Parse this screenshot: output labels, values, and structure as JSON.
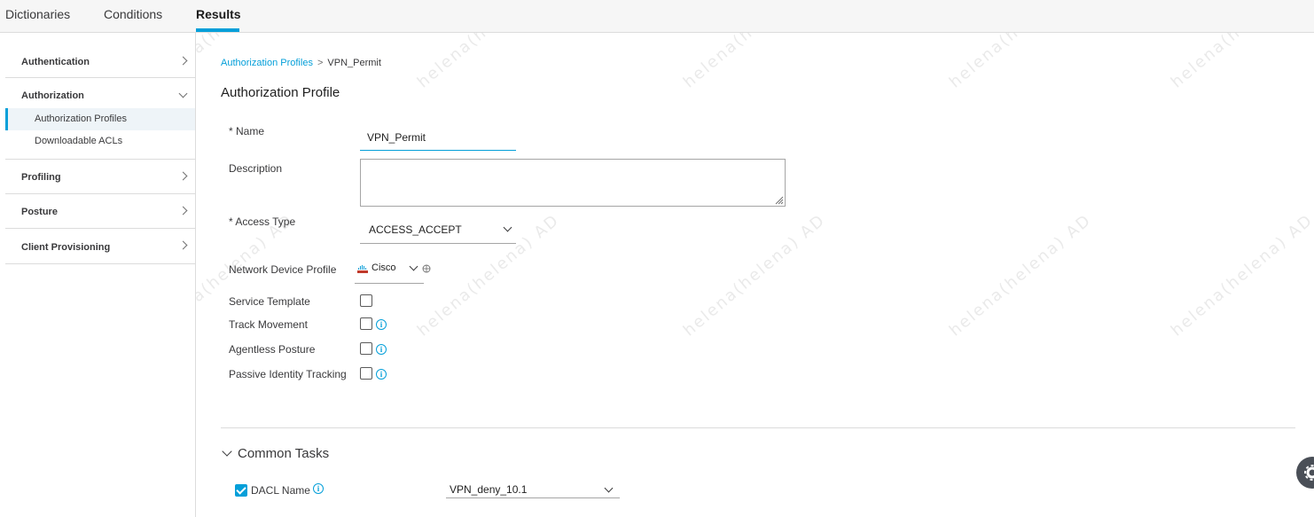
{
  "tabs": [
    {
      "label": "Dictionaries"
    },
    {
      "label": "Conditions"
    },
    {
      "label": "Results",
      "active": true
    }
  ],
  "sidebar": {
    "authentication": "Authentication",
    "authorization": "Authorization",
    "authorization_items": [
      "Authorization Profiles",
      "Downloadable ACLs"
    ],
    "profiling": "Profiling",
    "posture": "Posture",
    "client_provisioning": "Client Provisioning"
  },
  "breadcrumb": {
    "parent": "Authorization Profiles",
    "separator": ">",
    "current": "VPN_Permit"
  },
  "form": {
    "title": "Authorization Profile",
    "name_label": "* Name",
    "name_value": "VPN_Permit",
    "description_label": "Description",
    "description_value": "",
    "access_type_label": "* Access Type",
    "access_type_value": "ACCESS_ACCEPT",
    "network_device_profile_label": "Network Device Profile",
    "network_device_profile_value": "Cisco",
    "service_template_label": "Service Template",
    "track_movement_label": "Track Movement",
    "agentless_posture_label": "Agentless Posture",
    "passive_identity_label": "Passive Identity Tracking"
  },
  "common_tasks": {
    "title": "Common Tasks",
    "dacl_label": "DACL Name",
    "dacl_checked": true,
    "dacl_value": "VPN_deny_10.1"
  },
  "watermark": {
    "line1": "helena(helena)",
    "line2": "AD"
  },
  "colors": {
    "accent": "#049fd9",
    "text": "#39393b",
    "border": "#dcdcdc"
  }
}
